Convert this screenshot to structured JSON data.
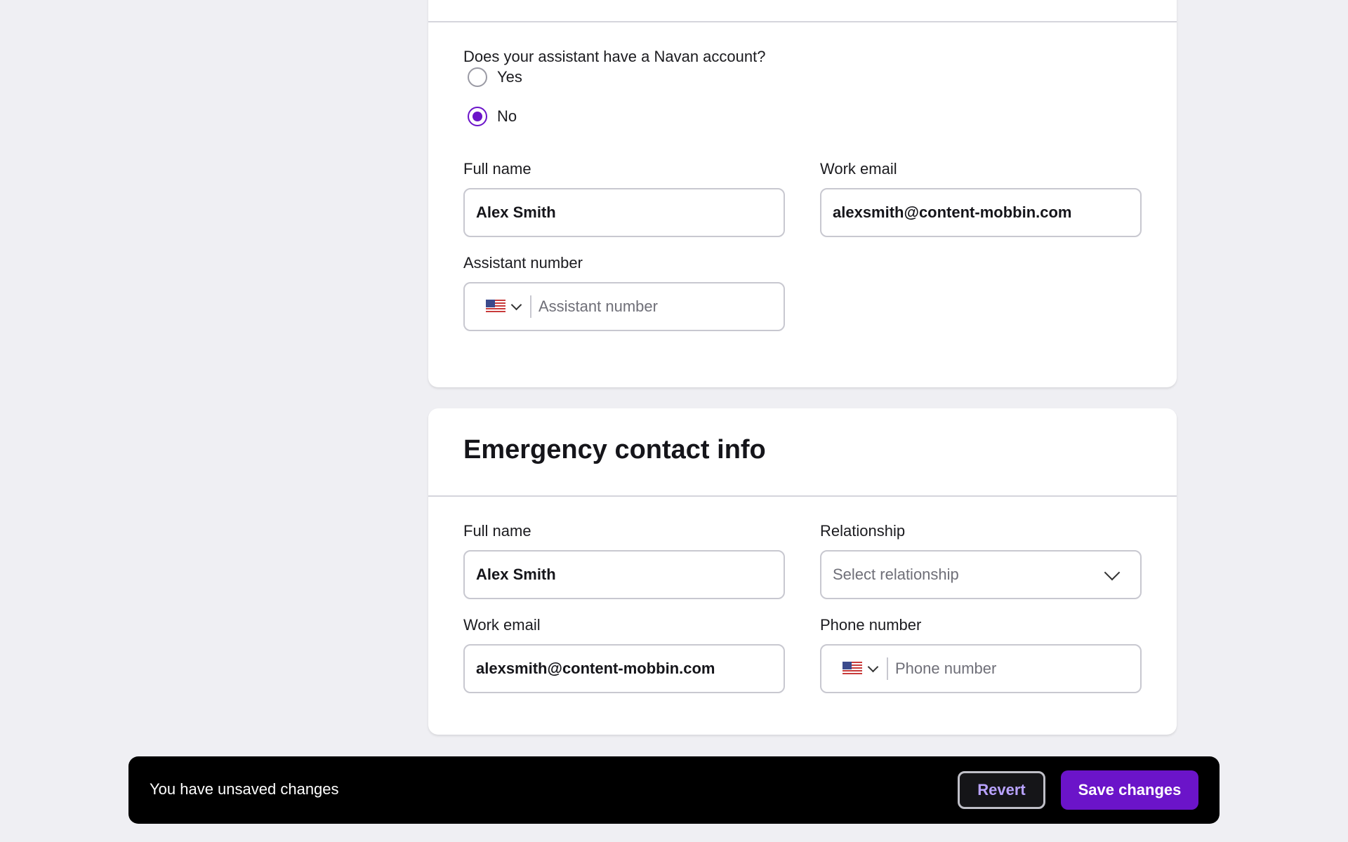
{
  "assistant_section": {
    "question": "Does your assistant have a Navan account?",
    "options": [
      {
        "label": "Yes",
        "checked": false
      },
      {
        "label": "No",
        "checked": true
      }
    ],
    "full_name_label": "Full name",
    "full_name_value": "Alex Smith",
    "work_email_label": "Work email",
    "work_email_value": "alexsmith@content-mobbin.com",
    "assistant_number_label": "Assistant number",
    "assistant_number_placeholder": "Assistant number",
    "country_flag_icon": "us-flag-icon"
  },
  "emergency_section": {
    "title": "Emergency contact info",
    "full_name_label": "Full name",
    "full_name_value": "Alex Smith",
    "relationship_label": "Relationship",
    "relationship_placeholder": "Select relationship",
    "work_email_label": "Work email",
    "work_email_value": "alexsmith@content-mobbin.com",
    "phone_label": "Phone number",
    "phone_placeholder": "Phone number",
    "country_flag_icon": "us-flag-icon"
  },
  "unsaved_bar": {
    "message": "You have unsaved changes",
    "revert_label": "Revert",
    "save_label": "Save changes"
  },
  "colors": {
    "accent": "#6b14c9",
    "page_background": "#efeff3",
    "bar_background": "#000000"
  }
}
